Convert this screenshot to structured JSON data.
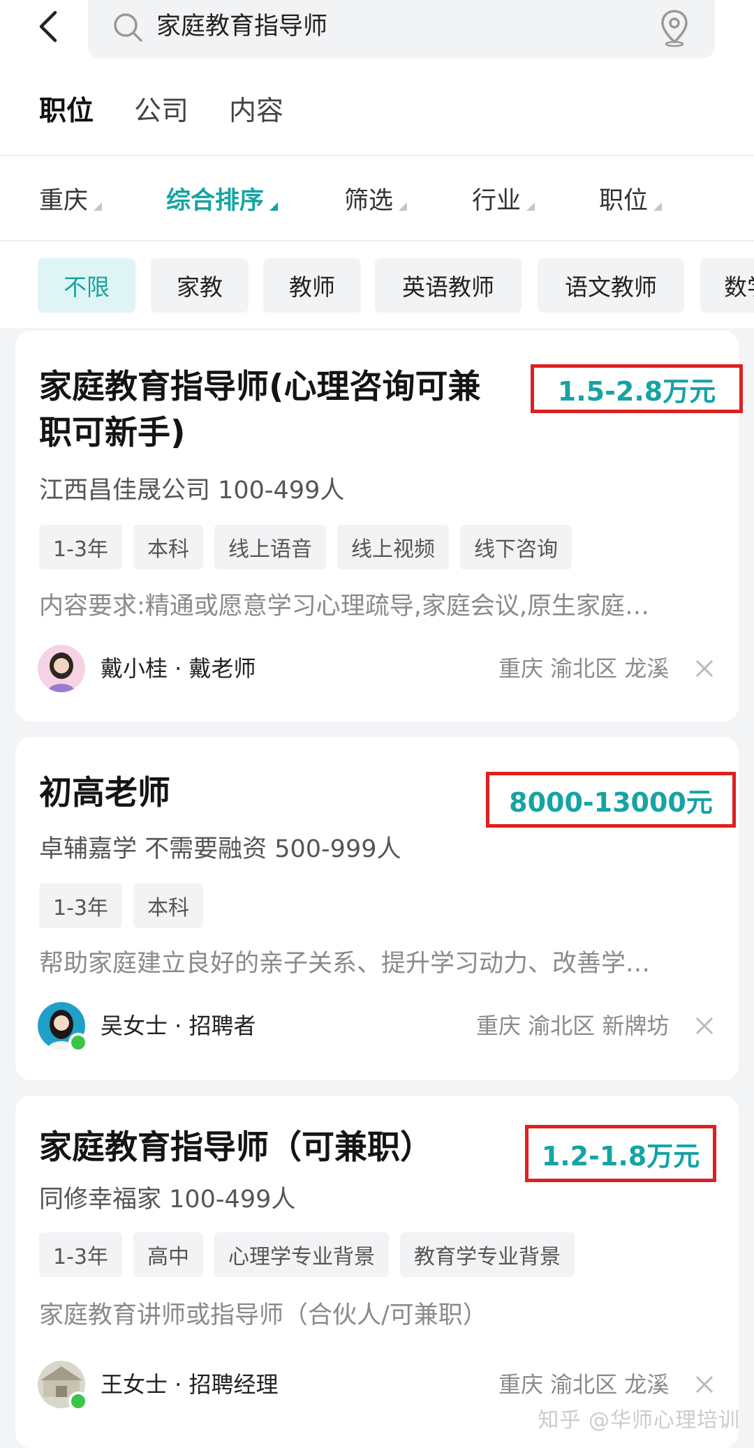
{
  "search": {
    "query": "家庭教育指导师"
  },
  "tabs": [
    {
      "label": "职位",
      "active": true
    },
    {
      "label": "公司",
      "active": false
    },
    {
      "label": "内容",
      "active": false
    }
  ],
  "filters": [
    {
      "label": "重庆",
      "active": false
    },
    {
      "label": "综合排序",
      "active": true
    },
    {
      "label": "筛选",
      "active": false
    },
    {
      "label": "行业",
      "active": false
    },
    {
      "label": "职位",
      "active": false
    }
  ],
  "chips": [
    {
      "label": "不限",
      "active": true
    },
    {
      "label": "家教",
      "active": false
    },
    {
      "label": "教师",
      "active": false
    },
    {
      "label": "英语教师",
      "active": false
    },
    {
      "label": "语文教师",
      "active": false
    },
    {
      "label": "数学",
      "active": false
    }
  ],
  "jobs": [
    {
      "title_line1": "家庭教育指导师(心理咨询可兼",
      "title_line2": "职可新手)",
      "salary": "1.5-2.8万元",
      "company": "江西昌佳晟公司 100-499人",
      "tags": [
        "1-3年",
        "本科",
        "线上语音",
        "线上视频",
        "线下咨询"
      ],
      "description": "内容要求:精通或愿意学习心理疏导,家庭会议,原生家庭…",
      "recruiter": "戴小桂 · 戴老师",
      "location": "重庆 渝北区 龙溪",
      "online": false
    },
    {
      "title_line1": "初高老师",
      "salary": "8000-13000元",
      "company": "卓辅嘉学 不需要融资 500-999人",
      "tags": [
        "1-3年",
        "本科"
      ],
      "description": "帮助家庭建立良好的亲子关系、提升学习动力、改善学…",
      "recruiter": "吴女士 · 招聘者",
      "location": "重庆 渝北区 新牌坊",
      "online": true
    },
    {
      "title_line1": "家庭教育指导师（可兼职）",
      "salary": "1.2-1.8万元",
      "company": "同修幸福家 100-499人",
      "tags": [
        "1-3年",
        "高中",
        "心理学专业背景",
        "教育学专业背景"
      ],
      "description": "家庭教育讲师或指导师（合伙人/可兼职）",
      "recruiter": "王女士 · 招聘经理",
      "location": "重庆 渝北区 龙溪",
      "online": true
    }
  ],
  "watermark": "知乎 @华师心理培训",
  "colors": {
    "accent": "#16a3a3",
    "highlight_border": "#e02020",
    "online": "#3cc34a"
  }
}
